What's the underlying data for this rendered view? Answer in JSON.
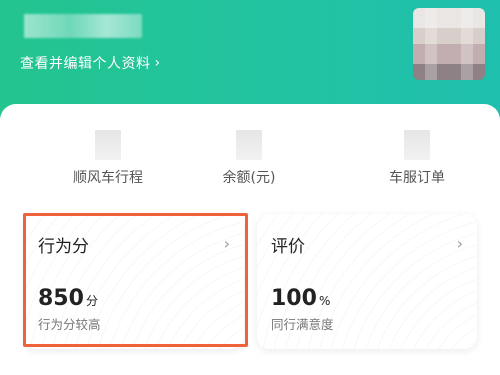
{
  "header": {
    "profile_link_label": "查看并编辑个人资料",
    "profile_link_chevron": "›",
    "background_start": "#23c48f",
    "background_end": "#1fbfae"
  },
  "stats": [
    {
      "label": "顺风车行程"
    },
    {
      "label": "余额(元)"
    },
    {
      "label": "车服订单"
    }
  ],
  "tiles": [
    {
      "title": "行为分",
      "value": "850",
      "unit": "分",
      "caption": "行为分较高",
      "chevron": "›"
    },
    {
      "title": "评价",
      "value": "100",
      "unit": "%",
      "caption": "同行满意度",
      "chevron": "›"
    }
  ],
  "highlight_color": "#f0623a"
}
